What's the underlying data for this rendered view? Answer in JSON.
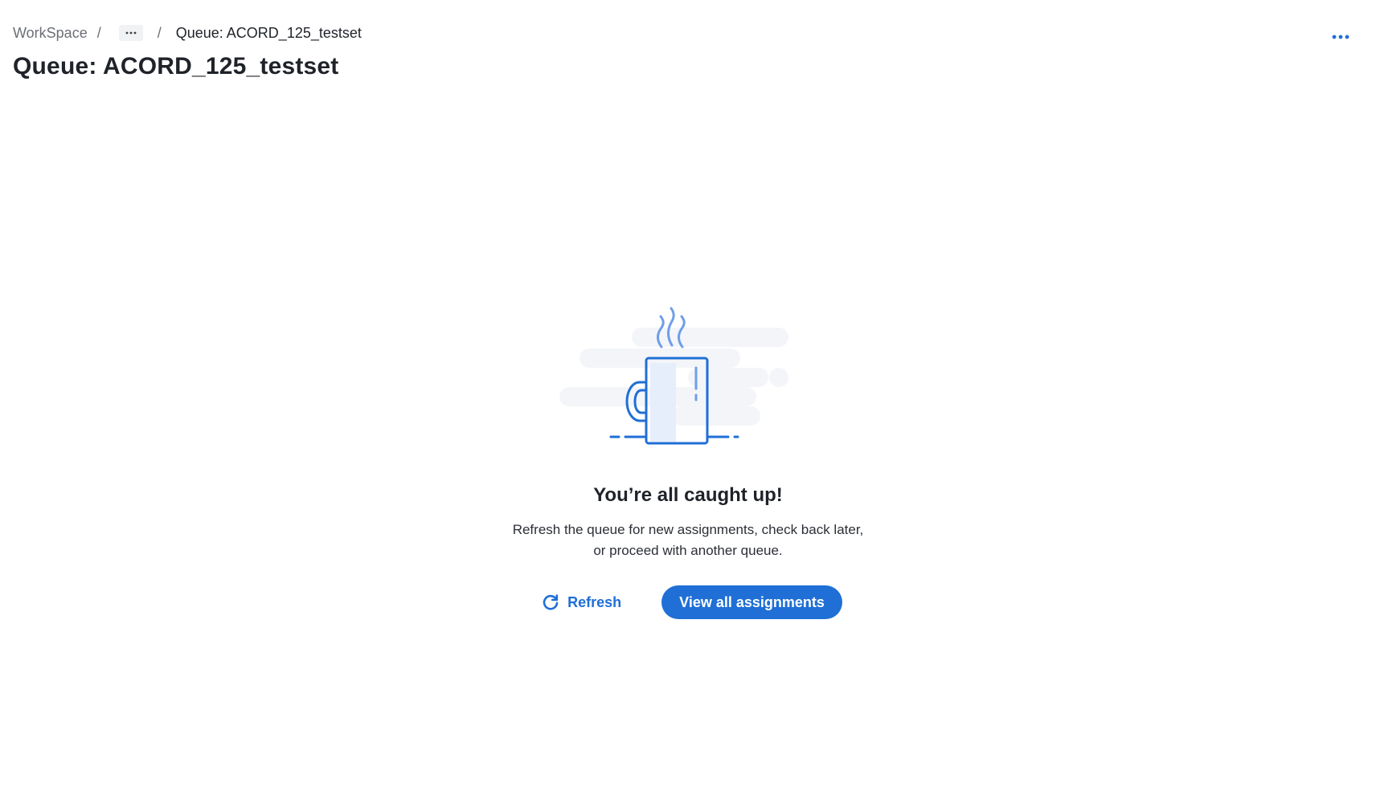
{
  "breadcrumb": {
    "root": "WorkSpace",
    "separator": "/",
    "current": "Queue: ACORD_125_testset"
  },
  "page": {
    "title": "Queue: ACORD_125_testset"
  },
  "empty_state": {
    "title": "You’re all caught up!",
    "message": "Refresh the queue for new assignments, check back later, or proceed with another queue."
  },
  "actions": {
    "refresh_label": "Refresh",
    "view_all_label": "View all assignments"
  },
  "icons": {
    "breadcrumb_more": "ellipsis-icon",
    "page_more": "ellipsis-icon",
    "refresh": "refresh-icon",
    "illustration": "coffee-mug-icon"
  },
  "colors": {
    "accent": "#1f6fd6",
    "illustration_light": "#e6eefb",
    "illustration_bg": "#f3f5f8"
  }
}
